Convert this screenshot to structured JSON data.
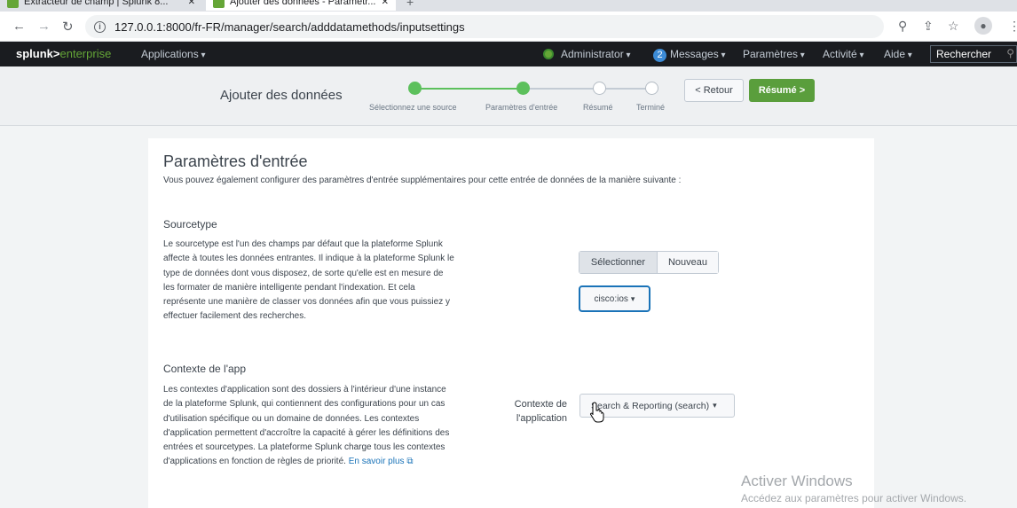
{
  "browser": {
    "tabs": [
      {
        "title": "Extracteur de champ | Splunk 8..."
      },
      {
        "title": "Ajouter des données - Paramètr..."
      }
    ],
    "new_tab_icon": "+",
    "url": "127.0.0.1:8000/fr-FR/manager/search/adddatamethods/inputsettings"
  },
  "splunk": {
    "brand_main": "splunk>",
    "brand_sub": "enterprise",
    "nav": {
      "apps": "Applications",
      "user": "Administrator",
      "messages_count": "2",
      "messages": "Messages",
      "settings": "Paramètres",
      "activity": "Activité",
      "help": "Aide",
      "search": "Rechercher"
    }
  },
  "wizard": {
    "title": "Ajouter des données",
    "steps": [
      {
        "label": "Sélectionnez une source",
        "state": "done"
      },
      {
        "label": "Paramètres d'entrée",
        "state": "done"
      },
      {
        "label": "Résumé",
        "state": "todo"
      },
      {
        "label": "Terminé",
        "state": "todo"
      }
    ],
    "back_label": "< Retour",
    "next_label": "Résumé >",
    "accent_color": "#5cc05c"
  },
  "main": {
    "title": "Paramètres d'entrée",
    "description": "Vous pouvez également configurer des paramètres d'entrée supplémentaires pour cette entrée de données de la manière suivante :",
    "sourcetype": {
      "heading": "Sourcetype",
      "text": "Le sourcetype est l'un des champs par défaut que la plateforme Splunk affecte à toutes les données entrantes. Il indique à la plateforme Splunk le type de données dont vous disposez, de sorte qu'elle est en mesure de les formater de manière intelligente pendant l'indexation. Et cela représente une manière de classer vos données afin que vous puissiez y effectuer facilement des recherches.",
      "toggle_select": "Sélectionner",
      "toggle_new": "Nouveau",
      "selected_value": "cisco:ios"
    },
    "app_context": {
      "heading": "Contexte de l'app",
      "text": "Les contextes d'application sont des dossiers à l'intérieur d'une instance de la plateforme Splunk, qui contiennent des configurations pour un cas d'utilisation spécifique ou un domaine de données. Les contextes d'application permettent d'accroître la capacité à gérer les définitions des entrées et sourcetypes. La plateforme Splunk charge tous les contextes d'applications en fonction de règles de priorité.",
      "link": "En savoir plus",
      "field_label": "Contexte de l'application",
      "selected_value": "Search & Reporting (search)"
    }
  },
  "watermark": {
    "line1": "Activer Windows",
    "line2": "Accédez aux paramètres pour activer Windows."
  }
}
